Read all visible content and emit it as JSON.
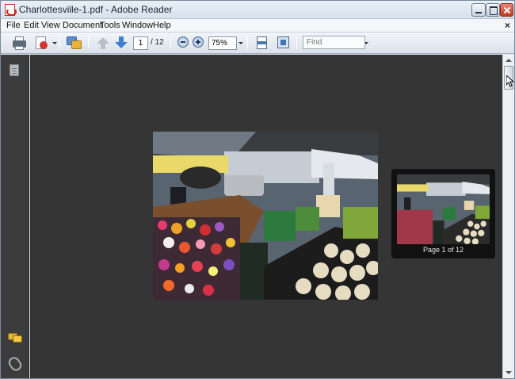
{
  "window": {
    "title": "Charlottesville-1.pdf - Adobe Reader",
    "doc_close_glyph": "×"
  },
  "menu": {
    "items": [
      "File",
      "Edit",
      "View",
      "Document",
      "Tools",
      "Window",
      "Help"
    ]
  },
  "toolbar": {
    "icons": [
      "print-icon",
      "share-icon",
      "review-icon",
      "previous-page-icon",
      "next-page-icon",
      "zoom-out-icon",
      "zoom-in-icon",
      "fit-page-icon",
      "full-screen-icon"
    ],
    "current_page": "1",
    "page_total": "/ 12",
    "zoom": "75%",
    "find_placeholder": "Find"
  },
  "nav_panel": {
    "icons": [
      "pages-icon",
      "comments-icon",
      "attachments-icon"
    ]
  },
  "document": {
    "photo_subject": "farmers market flower and melon stalls under tent"
  },
  "thumbnail_popup": {
    "label": "Page 1 of 12"
  },
  "colors": {
    "doc_background": "#353535",
    "nav_panel": "#3c3c3c",
    "popup": "#111111",
    "titlebar": "#dfe6ee"
  }
}
